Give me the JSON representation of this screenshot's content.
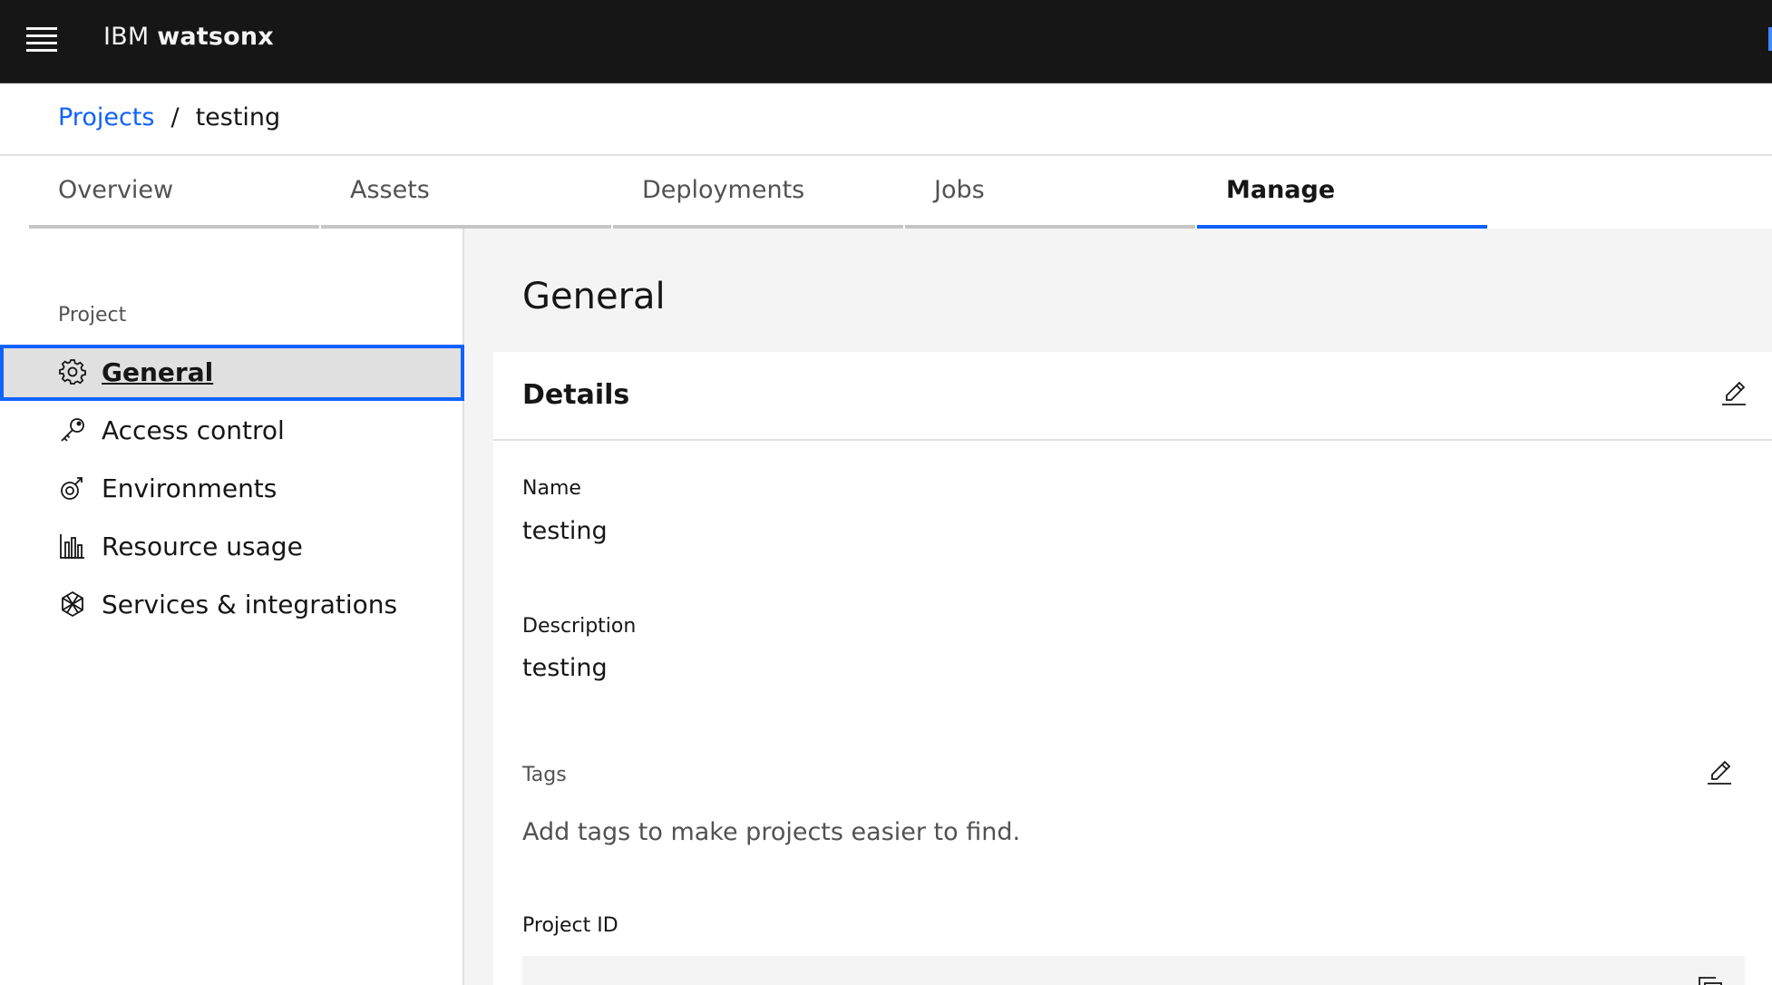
{
  "header": {
    "brand_prefix": "IBM",
    "brand_product": "watsonx",
    "menu_icon": "hamburger-menu-icon"
  },
  "breadcrumb": {
    "parent": "Projects",
    "separator": "/",
    "current": "testing"
  },
  "tabs": [
    {
      "label": "Overview",
      "active": false
    },
    {
      "label": "Assets",
      "active": false
    },
    {
      "label": "Deployments",
      "active": false
    },
    {
      "label": "Jobs",
      "active": false
    },
    {
      "label": "Manage",
      "active": true
    }
  ],
  "sidebar": {
    "section_label": "Project",
    "items": [
      {
        "label": "General",
        "icon": "gear-icon",
        "active": true
      },
      {
        "label": "Access control",
        "icon": "key-icon",
        "active": false
      },
      {
        "label": "Environments",
        "icon": "environments-icon",
        "active": false
      },
      {
        "label": "Resource usage",
        "icon": "bar-chart-icon",
        "active": false
      },
      {
        "label": "Services & integrations",
        "icon": "integrations-icon",
        "active": false
      }
    ]
  },
  "main": {
    "title": "General",
    "details": {
      "title": "Details",
      "name_label": "Name",
      "name_value": "testing",
      "description_label": "Description",
      "description_value": "testing",
      "tags_label": "Tags",
      "tags_hint": "Add tags to make projects easier to find.",
      "project_id_label": "Project ID"
    }
  },
  "colors": {
    "header_bg": "#161616",
    "accent": "#0f62fe",
    "main_bg": "#f4f4f4",
    "selected_bg": "#e0e0e0"
  }
}
